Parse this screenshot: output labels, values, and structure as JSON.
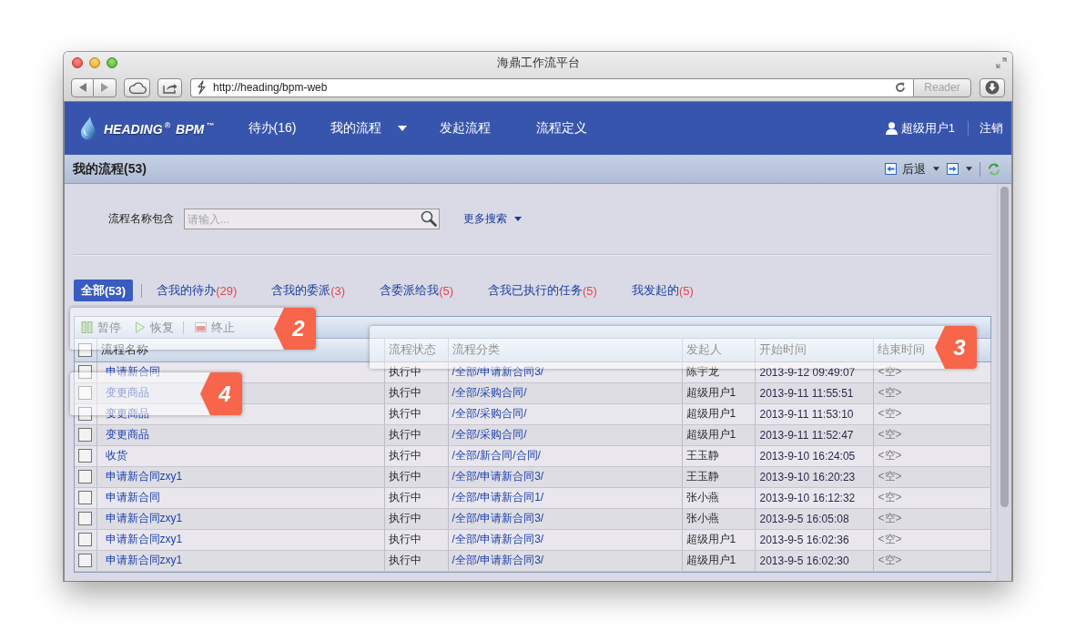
{
  "window": {
    "title": "海鼎工作流平台"
  },
  "browser": {
    "url": "http://heading/bpm-web",
    "reader": "Reader"
  },
  "navbar": {
    "logo": "HEADING$^{®}$ BPM$^{™}$",
    "items": [
      {
        "label": "待办(16)",
        "dropdown": false
      },
      {
        "label": "我的流程",
        "dropdown": true
      },
      {
        "label": "发起流程",
        "dropdown": false
      },
      {
        "label": "流程定义",
        "dropdown": false
      }
    ],
    "user": "超级用户1",
    "logout": "注销"
  },
  "panel": {
    "title": "我的流程(53)",
    "back": "后退"
  },
  "search": {
    "label": "流程名称包含",
    "placeholder": "请输入...",
    "more": "更多搜索"
  },
  "filters": [
    {
      "label": "全部",
      "count": "(53)",
      "selected": true
    },
    {
      "label": "含我的待办",
      "count": "(29)",
      "selected": false
    },
    {
      "label": "含我的委派",
      "count": "(3)",
      "selected": false
    },
    {
      "label": "含委派给我",
      "count": "(5)",
      "selected": false
    },
    {
      "label": "含我已执行的任务",
      "count": "(5)",
      "selected": false
    },
    {
      "label": "我发起的",
      "count": "(5)",
      "selected": false
    }
  ],
  "toolbar": [
    [
      {
        "kind": "pause",
        "label": "暂停"
      },
      {
        "kind": "resume",
        "label": "恢复"
      }
    ],
    [
      {
        "kind": "stop",
        "label": "终止"
      }
    ]
  ],
  "table": {
    "header_checked": false,
    "columns": [
      "流程名称",
      "流程状态",
      "流程分类",
      "发起人",
      "开始时间",
      "结束时间"
    ],
    "rows": [
      {
        "checked": false,
        "cells": [
          "申请新合同",
          "执行中",
          "/全部/申请新合同3/",
          "陈宇龙",
          "2013-9-12 09:49:07",
          "<空>"
        ]
      },
      {
        "checked": false,
        "cells": [
          "变更商品",
          "执行中",
          "/全部/采购合同/",
          "超级用户1",
          "2013-9-11 11:55:51",
          "<空>"
        ]
      },
      {
        "checked": false,
        "cells": [
          "变更商品",
          "执行中",
          "/全部/采购合同/",
          "超级用户1",
          "2013-9-11 11:53:10",
          "<空>"
        ]
      },
      {
        "checked": false,
        "cells": [
          "变更商品",
          "执行中",
          "/全部/采购合同/",
          "超级用户1",
          "2013-9-11 11:52:47",
          "<空>"
        ]
      },
      {
        "checked": false,
        "cells": [
          "收货",
          "执行中",
          "/全部/新合同/合同/",
          "王玉静",
          "2013-9-10 16:24:05",
          "<空>"
        ]
      },
      {
        "checked": false,
        "cells": [
          "申请新合同zxy1",
          "执行中",
          "/全部/申请新合同3/",
          "王玉静",
          "2013-9-10 16:20:23",
          "<空>"
        ]
      },
      {
        "checked": false,
        "cells": [
          "申请新合同",
          "执行中",
          "/全部/申请新合同1/",
          "张小燕",
          "2013-9-10 16:12:32",
          "<空>"
        ]
      },
      {
        "checked": false,
        "cells": [
          "申请新合同zxy1",
          "执行中",
          "/全部/申请新合同3/",
          "张小燕",
          "2013-9-5 16:05:08",
          "<空>"
        ]
      },
      {
        "checked": false,
        "cells": [
          "申请新合同zxy1",
          "执行中",
          "/全部/申请新合同3/",
          "超级用户1",
          "2013-9-5 16:02:36",
          "<空>"
        ]
      },
      {
        "checked": false,
        "cells": [
          "申请新合同zxy1",
          "执行中",
          "/全部/申请新合同3/",
          "超级用户1",
          "2013-9-5 16:02:30",
          "<空>"
        ]
      }
    ]
  },
  "callouts": [
    {
      "kind": "toolbar",
      "number": "2"
    },
    {
      "kind": "columns",
      "number": "3"
    },
    {
      "kind": "row",
      "number": "4"
    }
  ]
}
